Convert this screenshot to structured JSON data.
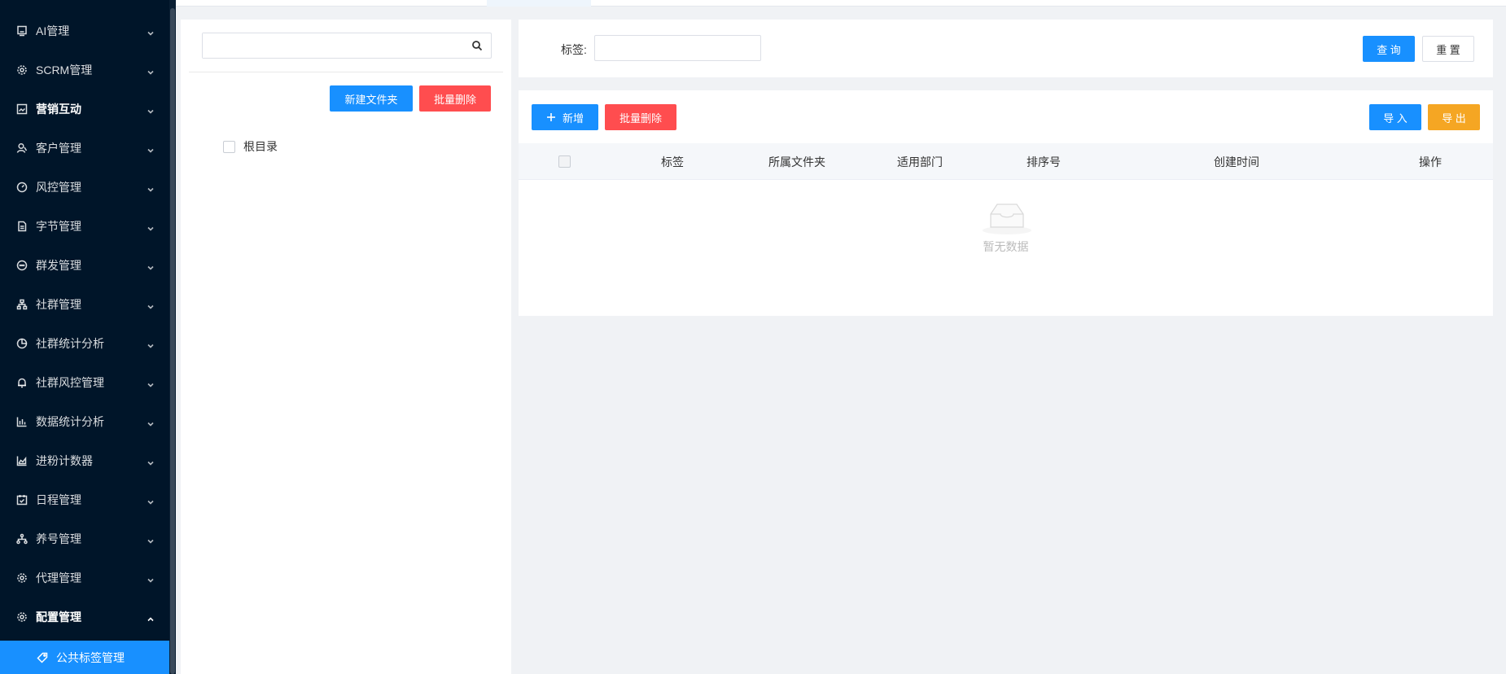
{
  "sidebar": {
    "items": [
      {
        "label": "AI管理",
        "icon": "monitor-icon",
        "bold": false
      },
      {
        "label": "SCRM管理",
        "icon": "gear-icon",
        "bold": false
      },
      {
        "label": "营销互动",
        "icon": "image-frame-icon",
        "bold": true
      },
      {
        "label": "客户管理",
        "icon": "user-icon",
        "bold": false
      },
      {
        "label": "风控管理",
        "icon": "gauge-icon",
        "bold": false
      },
      {
        "label": "字节管理",
        "icon": "document-icon",
        "bold": false
      },
      {
        "label": "群发管理",
        "icon": "chat-bubble-icon",
        "bold": false
      },
      {
        "label": "社群管理",
        "icon": "org-chart-icon",
        "bold": false
      },
      {
        "label": "社群统计分析",
        "icon": "pie-chart-icon",
        "bold": false
      },
      {
        "label": "社群风控管理",
        "icon": "bell-icon",
        "bold": false
      },
      {
        "label": "数据统计分析",
        "icon": "bar-chart-icon",
        "bold": false
      },
      {
        "label": "进粉计数器",
        "icon": "area-chart-icon",
        "bold": false
      },
      {
        "label": "日程管理",
        "icon": "calendar-check-icon",
        "bold": false
      },
      {
        "label": "养号管理",
        "icon": "network-icon",
        "bold": false
      },
      {
        "label": "代理管理",
        "icon": "gear-icon",
        "bold": false
      },
      {
        "label": "配置管理",
        "icon": "gear-icon",
        "bold": true,
        "expanded": true
      }
    ],
    "active_sub": {
      "label": "公共标签管理",
      "icon": "tag-icon"
    },
    "colors": {
      "background": "#001529",
      "active": "#1890ff"
    }
  },
  "folder_panel": {
    "search": {
      "value": "",
      "placeholder": ""
    },
    "new_folder_label": "新建文件夹",
    "batch_delete_label": "批量删除",
    "tree": [
      {
        "label": "根目录",
        "checked": false
      }
    ]
  },
  "query": {
    "tag_label": "标签:",
    "tag_value": "",
    "search_label": "查 询",
    "reset_label": "重 置"
  },
  "toolbar": {
    "add_label": "新增",
    "batch_delete_label": "批量删除",
    "import_label": "导 入",
    "export_label": "导 出"
  },
  "table": {
    "columns": [
      "标签",
      "所属文件夹",
      "适用部门",
      "排序号",
      "创建时间",
      "操作"
    ],
    "rows": [],
    "empty_text": "暂无数据"
  },
  "colors": {
    "primary": "#1890ff",
    "danger": "#ff4d4f",
    "warning": "#f5a623"
  }
}
